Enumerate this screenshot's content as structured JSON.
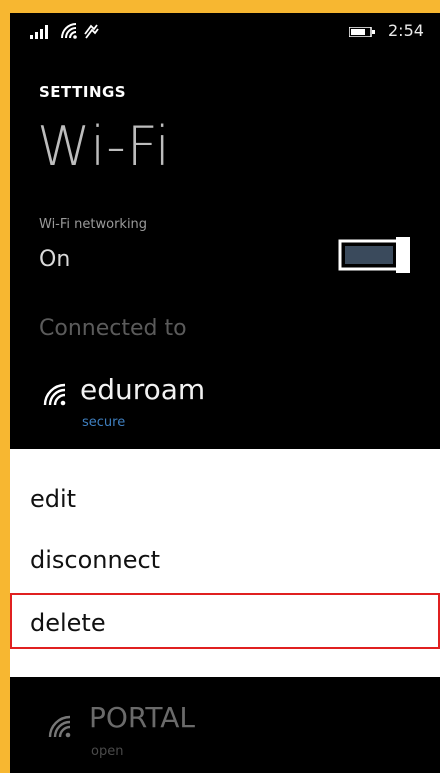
{
  "status_bar": {
    "time": "2:54",
    "icons": [
      "signal-icon",
      "wifi-icon",
      "vibrate-icon",
      "battery-icon"
    ]
  },
  "header": {
    "section": "SETTINGS",
    "title": "Wi-Fi"
  },
  "wifi_networking": {
    "label": "Wi-Fi networking",
    "state": "On",
    "toggle_on": true
  },
  "connected": {
    "label": "Connected to",
    "network_name": "eduroam",
    "network_status": "secure"
  },
  "context_menu": {
    "items": [
      {
        "label": "edit"
      },
      {
        "label": "disconnect"
      },
      {
        "label": "delete",
        "highlighted": true
      }
    ]
  },
  "other_networks": [
    {
      "name": "PORTAL",
      "status": "open"
    }
  ],
  "colors": {
    "frame_border": "#f7b731",
    "background": "#000000",
    "accent": "#3f7fbf",
    "highlight_border": "#e02020"
  }
}
